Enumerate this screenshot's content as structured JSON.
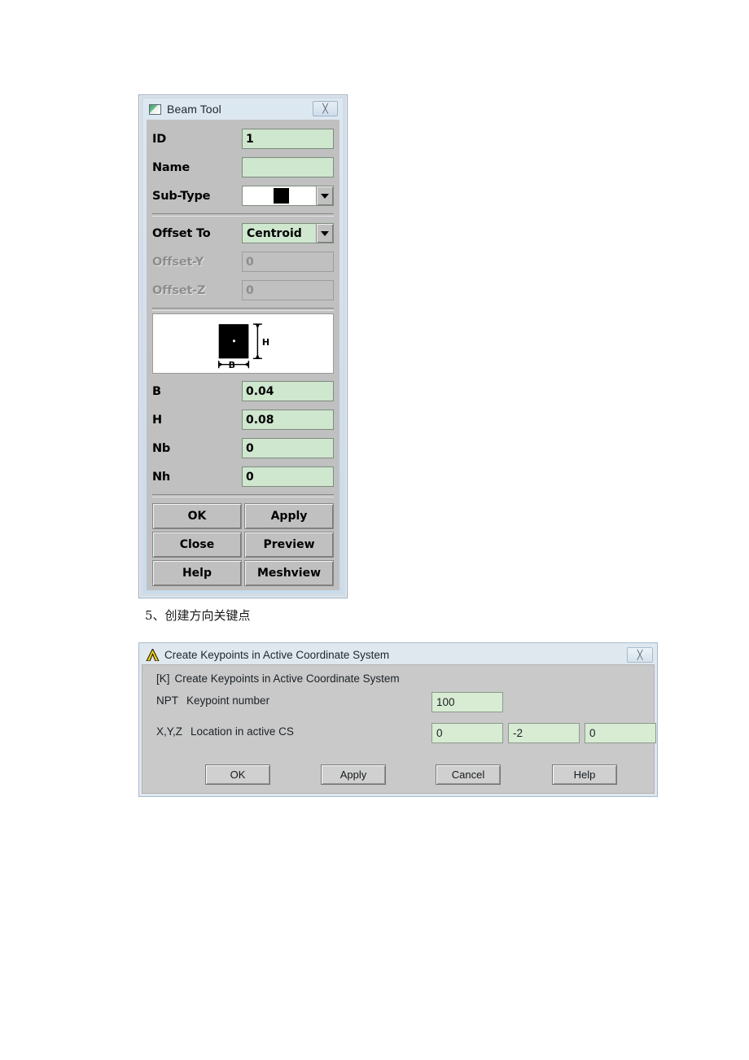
{
  "beam_tool": {
    "title": "Beam Tool",
    "icon": "beam-section-icon",
    "close_glyph": "╳",
    "fields": [
      {
        "label": "ID",
        "value": "1",
        "type": "text",
        "disabled": false
      },
      {
        "label": "Name",
        "value": "",
        "type": "text",
        "disabled": false
      },
      {
        "label": "Sub-Type",
        "value": "",
        "type": "select-swatch",
        "disabled": false
      }
    ],
    "offset_fields": [
      {
        "label": "Offset To",
        "value": "Centroid",
        "type": "select",
        "disabled": false
      },
      {
        "label": "Offset-Y",
        "value": "0",
        "type": "text",
        "disabled": true
      },
      {
        "label": "Offset-Z",
        "value": "0",
        "type": "text",
        "disabled": true
      }
    ],
    "preview": {
      "name": "rectangular-beam-section-preview",
      "height_label": "H",
      "width_label": "B"
    },
    "dimension_fields": [
      {
        "label": "B",
        "value": "0.04"
      },
      {
        "label": "H",
        "value": "0.08"
      },
      {
        "label": "Nb",
        "value": "0"
      },
      {
        "label": "Nh",
        "value": "0"
      }
    ],
    "buttons": [
      [
        "OK",
        "Apply"
      ],
      [
        "Close",
        "Preview"
      ],
      [
        "Help",
        "Meshview"
      ]
    ]
  },
  "caption": {
    "text": "5、创建方向关键点"
  },
  "keypoint_dialog": {
    "title": "Create Keypoints in Active Coordinate System",
    "logo": "ansys-lambda-logo",
    "close_glyph": "╳",
    "headline_code": "[K]",
    "headline_text": "Create Keypoints in Active Coordinate System",
    "npt_row": {
      "code": "NPT",
      "label": "Keypoint number",
      "value": "100"
    },
    "xyz_row": {
      "code": "X,Y,Z",
      "label": "Location in active CS",
      "values": [
        "0",
        "-2",
        "0"
      ]
    },
    "buttons": [
      "OK",
      "Apply",
      "Cancel",
      "Help"
    ]
  },
  "colors": {
    "field_green": "#cfe6cf",
    "dialog_face": "#c0c0c0",
    "aero_frame": "#d3dce6",
    "kp_field_green": "#d8ebd3"
  }
}
